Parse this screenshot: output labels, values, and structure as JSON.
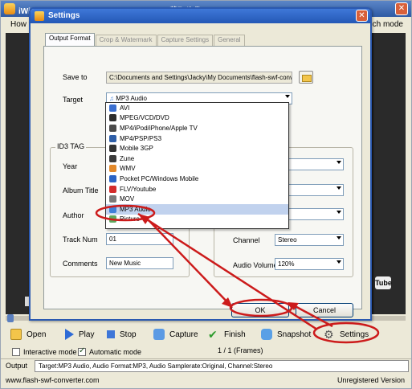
{
  "app": {
    "title": "iWisoft Flash/SWF to Video Converter  - 截取头像 - swf",
    "menu_left": "How t",
    "menu_right": "ch mode",
    "video_brand": "Tube",
    "toolbar": {
      "open": "Open",
      "play": "Play",
      "stop": "Stop",
      "capture": "Capture",
      "finish": "Finish",
      "snapshot": "Snapshot",
      "settings": "Settings"
    },
    "options": {
      "interactive": "Interactive mode",
      "automatic": "Automatic mode",
      "interactive_checked": false,
      "automatic_checked": true
    },
    "frames": "1 / 1 (Frames)",
    "output_label": "Output",
    "output_value": "Target:MP3 Audio, Audio Format:MP3, Audio Samplerate:Original, Channel:Stereo",
    "status_url": "www.flash-swf-converter.com",
    "status_version": "Unregistered Version"
  },
  "dialog": {
    "title": "Settings",
    "tabs": [
      "Output Format",
      "Crop & Watermark",
      "Capture Settings",
      "General"
    ],
    "save_to_label": "Save to",
    "save_to_value": "C:\\Documents and Settings\\Jacky\\My Documents\\flash-swf-converter",
    "target_label": "Target",
    "target_value": "MP3 Audio",
    "id3_title": "ID3 TAG",
    "year_label": "Year",
    "album_label": "Album Title",
    "author_label": "Author",
    "track_label": "Track Num",
    "track_value": "01",
    "comments_label": "Comments",
    "comments_value": "New Music",
    "right_partial": {
      "bitrate_suffix": "bps",
      "samplerate_suffix": "al"
    },
    "channel_label": "Channel",
    "channel_value": "Stereo",
    "volume_label": "Audio Volume",
    "volume_value": "120%",
    "ok": "OK",
    "cancel": "Cancel",
    "target_options": [
      {
        "label": "AVI",
        "color": "#3a6fd0"
      },
      {
        "label": "MPEG/VCD/DVD",
        "color": "#2d2d2d"
      },
      {
        "label": "MP4/iPod/iPhone/Apple TV",
        "color": "#4a4a4a"
      },
      {
        "label": "MP4/PSP/PS3",
        "color": "#2f5fa8"
      },
      {
        "label": "Mobile 3GP",
        "color": "#333333"
      },
      {
        "label": "Zune",
        "color": "#3c3c3c"
      },
      {
        "label": "WMV",
        "color": "#e2882a"
      },
      {
        "label": "Pocket PC/Windows Mobile",
        "color": "#2b63c4"
      },
      {
        "label": "FLV/Youtube",
        "color": "#d32b2b"
      },
      {
        "label": "MOV",
        "color": "#7a7a7a"
      },
      {
        "label": "MP3 Audio",
        "color": "#3f7fd8"
      },
      {
        "label": "Picture",
        "color": "#5fa85f"
      }
    ],
    "selected_option": "MP3 Audio"
  },
  "colors": {
    "accent": "#2b59b0",
    "annotation_red": "#cc1b1b"
  }
}
